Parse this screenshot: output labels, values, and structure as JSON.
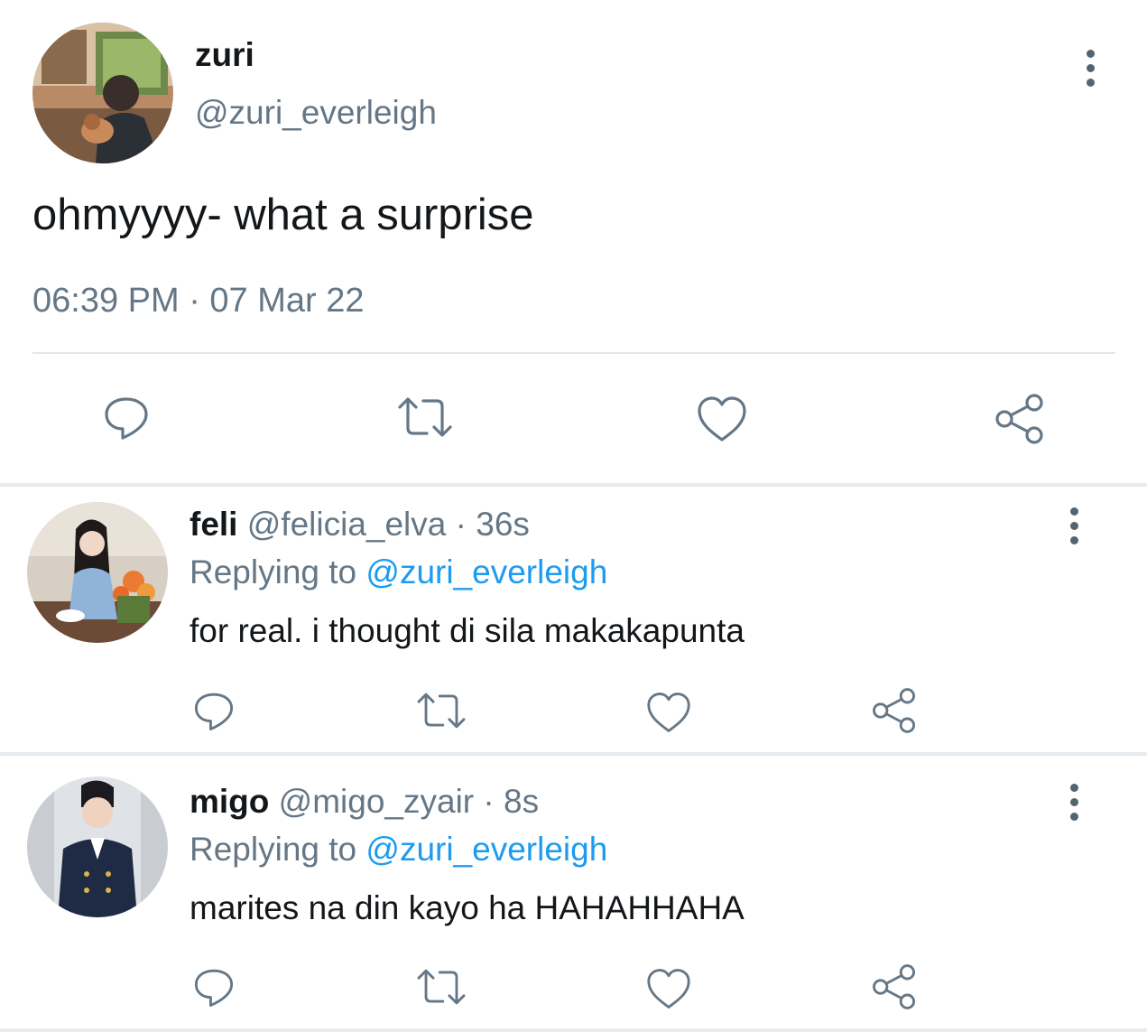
{
  "main_tweet": {
    "display_name": "zuri",
    "handle": "@zuri_everleigh",
    "text": "ohmyyyy- what a surprise",
    "timestamp": "06:39 PM · 07 Mar 22",
    "avatar_icon": "user-photo-holding-baby"
  },
  "replies": [
    {
      "display_name": "feli",
      "handle": "@felicia_elva",
      "age": "36s",
      "replying_label": "Replying to",
      "replying_to": "@zuri_everleigh",
      "text": "for real. i thought di sila makakapunta",
      "avatar_icon": "user-photo-woman-flowers"
    },
    {
      "display_name": "migo",
      "handle": "@migo_zyair",
      "age": "8s",
      "replying_label": "Replying to",
      "replying_to": "@zuri_everleigh",
      "text": "marites na din kayo ha HAHAHHAHA",
      "avatar_icon": "user-photo-man-uniform"
    }
  ],
  "separator": "·",
  "icons": {
    "reply": "reply-icon",
    "retweet": "retweet-icon",
    "like": "heart-icon",
    "share": "share-icon",
    "more": "more-vertical-icon"
  },
  "colors": {
    "text": "#14171a",
    "muted": "#657786",
    "link": "#1d9bf0",
    "divider": "#e1e8ed"
  }
}
